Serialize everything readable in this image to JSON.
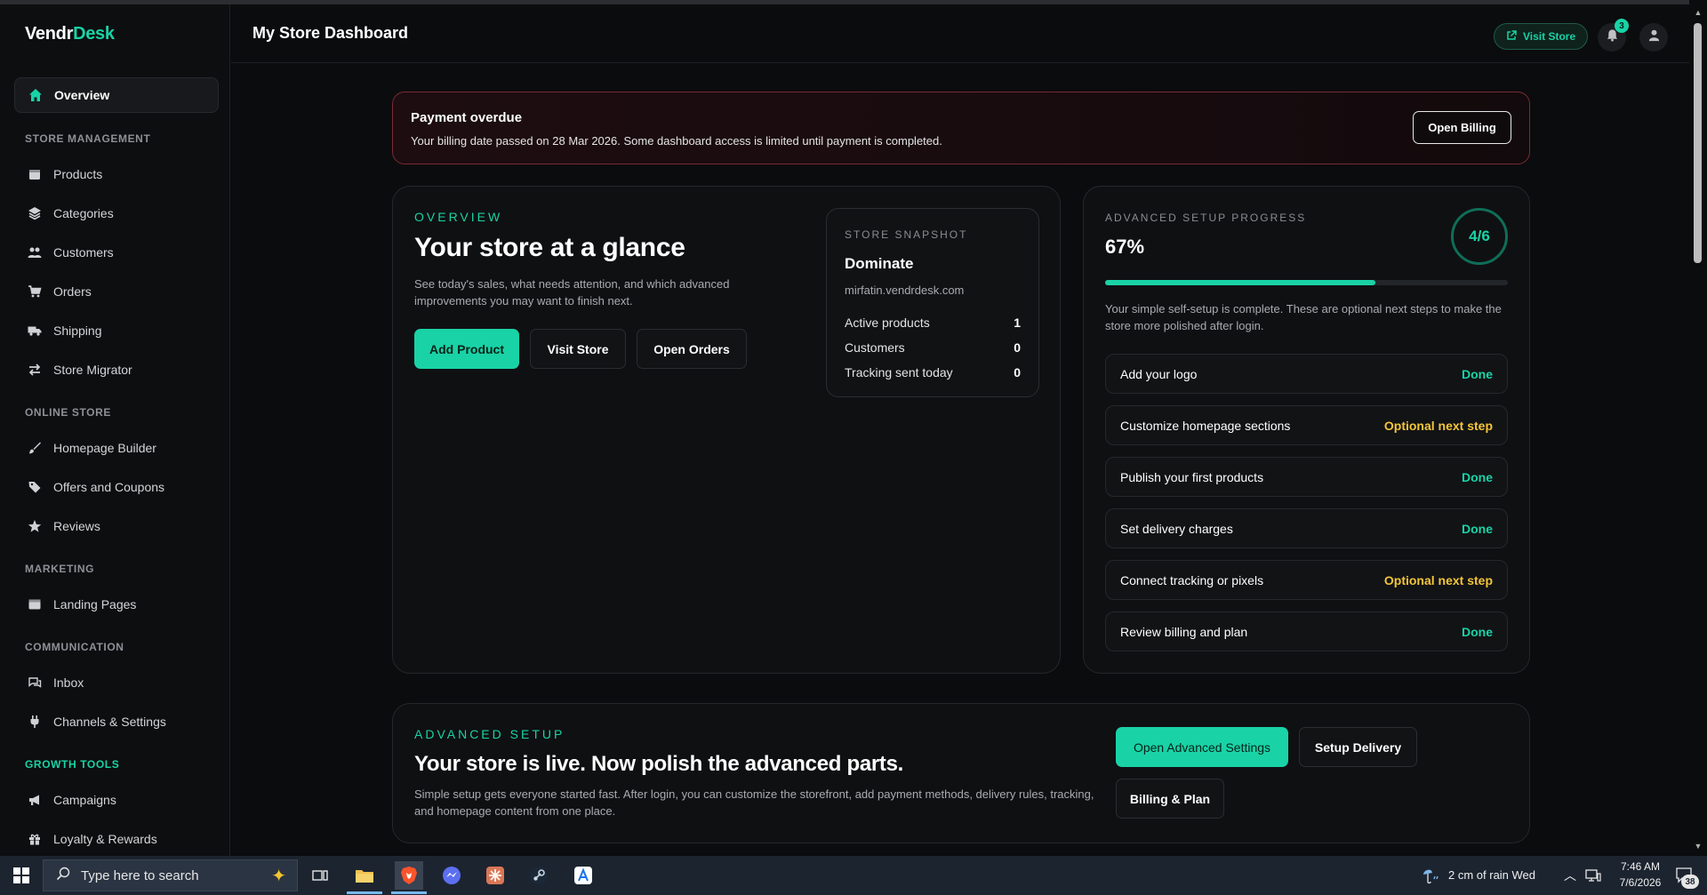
{
  "brand": {
    "part1": "Vendr",
    "part2": "Desk"
  },
  "sidebar": {
    "overview": "Overview",
    "sections": [
      {
        "title": "STORE MANAGEMENT"
      },
      {
        "title": "ONLINE STORE"
      },
      {
        "title": "MARKETING"
      },
      {
        "title": "COMMUNICATION"
      },
      {
        "title": "GROWTH TOOLS"
      }
    ],
    "items": {
      "products": "Products",
      "categories": "Categories",
      "customers": "Customers",
      "orders": "Orders",
      "shipping": "Shipping",
      "store_migrator": "Store Migrator",
      "homepage_builder": "Homepage Builder",
      "offers": "Offers and Coupons",
      "reviews": "Reviews",
      "landing_pages": "Landing Pages",
      "inbox": "Inbox",
      "channels": "Channels & Settings",
      "campaigns": "Campaigns",
      "loyalty": "Loyalty & Rewards"
    }
  },
  "header": {
    "title": "My Store Dashboard",
    "visit_store": "Visit Store",
    "notification_count": "3"
  },
  "alert": {
    "title": "Payment overdue",
    "text": "Your billing date passed on 28 Mar 2026. Some dashboard access is limited until payment is completed.",
    "button": "Open Billing"
  },
  "overview": {
    "eyebrow": "OVERVIEW",
    "title": "Your store at a glance",
    "description": "See today's sales, what needs attention, and which advanced improvements you may want to finish next.",
    "buttons": {
      "add_product": "Add Product",
      "visit_store": "Visit Store",
      "open_orders": "Open Orders"
    },
    "snapshot": {
      "eyebrow": "STORE SNAPSHOT",
      "name": "Dominate",
      "domain": "mirfatin.vendrdesk.com",
      "rows": [
        {
          "label": "Active products",
          "value": "1"
        },
        {
          "label": "Customers",
          "value": "0"
        },
        {
          "label": "Tracking sent today",
          "value": "0"
        }
      ]
    }
  },
  "progress": {
    "eyebrow": "ADVANCED SETUP PROGRESS",
    "percent_text": "67%",
    "percent_value": 0.67,
    "ring": "4/6",
    "description": "Your simple self-setup is complete. These are optional next steps to make the store more polished after login.",
    "steps": [
      {
        "label": "Add your logo",
        "status": "Done"
      },
      {
        "label": "Customize homepage sections",
        "status": "Optional next step"
      },
      {
        "label": "Publish your first products",
        "status": "Done"
      },
      {
        "label": "Set delivery charges",
        "status": "Done"
      },
      {
        "label": "Connect tracking or pixels",
        "status": "Optional next step"
      },
      {
        "label": "Review billing and plan",
        "status": "Done"
      }
    ]
  },
  "advanced": {
    "eyebrow": "ADVANCED SETUP",
    "title": "Your store is live. Now polish the advanced parts.",
    "description": "Simple setup gets everyone started fast. After login, you can customize the storefront, add payment methods, delivery rules, tracking, and homepage content from one place.",
    "buttons": {
      "open_advanced": "Open Advanced Settings",
      "setup_delivery": "Setup Delivery",
      "billing_plan": "Billing & Plan"
    }
  },
  "taskbar": {
    "search_placeholder": "Type here to search",
    "weather": "2 cm of rain Wed",
    "time": "7:46 AM",
    "date": "7/6/2026",
    "notifications": "38"
  },
  "colors": {
    "accent": "#19d3a6",
    "warning": "#f3c53a",
    "danger_border": "#7a2a35",
    "background": "#0b0c0e"
  }
}
